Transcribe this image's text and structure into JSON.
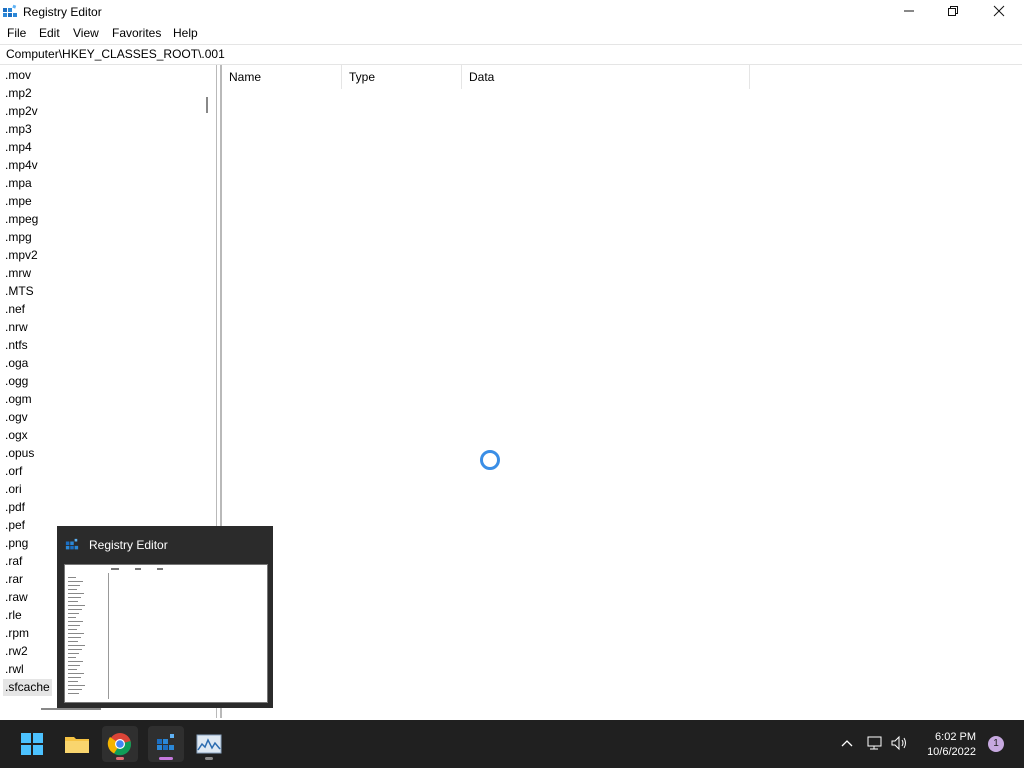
{
  "window": {
    "title": "Registry Editor",
    "minimize_label": "—",
    "maximize_label": "▢",
    "close_label": "✕"
  },
  "menu": {
    "items": [
      "File",
      "Edit",
      "View",
      "Favorites",
      "Help"
    ]
  },
  "address": {
    "path": "Computer\\HKEY_CLASSES_ROOT\\.001"
  },
  "tree": {
    "items": [
      ".mov",
      ".mp2",
      ".mp2v",
      ".mp3",
      ".mp4",
      ".mp4v",
      ".mpa",
      ".mpe",
      ".mpeg",
      ".mpg",
      ".mpv2",
      ".mrw",
      ".MTS",
      ".nef",
      ".nrw",
      ".ntfs",
      ".oga",
      ".ogg",
      ".ogm",
      ".ogv",
      ".ogx",
      ".opus",
      ".orf",
      ".ori",
      ".pdf",
      ".pef",
      ".png",
      ".raf",
      ".rar",
      ".raw",
      ".rle",
      ".rpm",
      ".rw2",
      ".rwl",
      ".sfcache"
    ],
    "selected": ".sfcache"
  },
  "values_pane": {
    "columns": [
      "Name",
      "Type",
      "Data"
    ]
  },
  "preview": {
    "title": "Registry Editor"
  },
  "taskbar": {
    "apps": [
      {
        "name": "start",
        "icon": "windows-start-icon"
      },
      {
        "name": "file-explorer",
        "icon": "folder-icon"
      },
      {
        "name": "chrome",
        "icon": "chrome-icon"
      },
      {
        "name": "registry-editor",
        "icon": "registry-editor-icon"
      },
      {
        "name": "resource-monitor",
        "icon": "performance-monitor-icon"
      }
    ],
    "clock_time": "6:02 PM",
    "clock_date": "10/6/2022",
    "notification_count": "1"
  },
  "colors": {
    "accent": "#3a8ee6",
    "taskbar": "#202020",
    "selection": "#e5e5e5"
  }
}
